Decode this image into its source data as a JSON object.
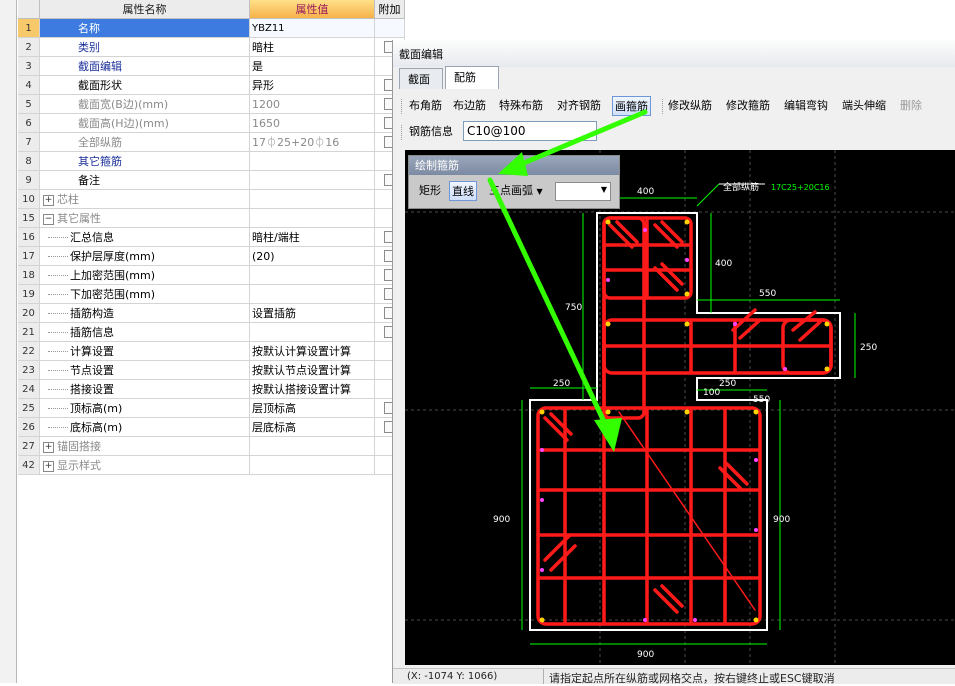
{
  "grid": {
    "headers": {
      "name": "属性名称",
      "value": "属性值",
      "extra": "附加"
    },
    "rows": [
      {
        "num": "1",
        "name": "名称",
        "value": "YBZ11",
        "check": false,
        "style": "sel"
      },
      {
        "num": "2",
        "name": "类别",
        "value": "暗柱",
        "check": true,
        "style": "blue"
      },
      {
        "num": "3",
        "name": "截面编辑",
        "value": "是",
        "check": false,
        "style": "blue"
      },
      {
        "num": "4",
        "name": "截面形状",
        "value": "异形",
        "check": true,
        "style": ""
      },
      {
        "num": "5",
        "name": "截面宽(B边)(mm)",
        "value": "1200",
        "check": true,
        "style": "gray"
      },
      {
        "num": "6",
        "name": "截面高(H边)(mm)",
        "value": "1650",
        "check": true,
        "style": "gray"
      },
      {
        "num": "7",
        "name": "全部纵筋",
        "value": "17⏀25+20⏀16",
        "check": true,
        "style": "gray"
      },
      {
        "num": "8",
        "name": "其它箍筋",
        "value": "",
        "check": false,
        "style": "blue"
      },
      {
        "num": "9",
        "name": "备注",
        "value": "",
        "check": true,
        "style": ""
      },
      {
        "num": "10",
        "name": "芯柱",
        "value": "",
        "check": false,
        "style": "group",
        "sign": "+"
      },
      {
        "num": "15",
        "name": "其它属性",
        "value": "",
        "check": false,
        "style": "group",
        "sign": "−"
      },
      {
        "num": "16",
        "name": "汇总信息",
        "value": "暗柱/端柱",
        "check": true,
        "style": "child"
      },
      {
        "num": "17",
        "name": "保护层厚度(mm)",
        "value": "(20)",
        "check": true,
        "style": "child"
      },
      {
        "num": "18",
        "name": "上加密范围(mm)",
        "value": "",
        "check": true,
        "style": "child"
      },
      {
        "num": "19",
        "name": "下加密范围(mm)",
        "value": "",
        "check": true,
        "style": "child"
      },
      {
        "num": "20",
        "name": "插筋构造",
        "value": "设置插筋",
        "check": true,
        "style": "child"
      },
      {
        "num": "21",
        "name": "插筋信息",
        "value": "",
        "check": true,
        "style": "child"
      },
      {
        "num": "22",
        "name": "计算设置",
        "value": "按默认计算设置计算",
        "check": false,
        "style": "child"
      },
      {
        "num": "23",
        "name": "节点设置",
        "value": "按默认节点设置计算",
        "check": false,
        "style": "child"
      },
      {
        "num": "24",
        "name": "搭接设置",
        "value": "按默认搭接设置计算",
        "check": false,
        "style": "child"
      },
      {
        "num": "25",
        "name": "顶标高(m)",
        "value": "层顶标高",
        "check": true,
        "style": "child"
      },
      {
        "num": "26",
        "name": "底标高(m)",
        "value": "层底标高",
        "check": true,
        "style": "child"
      },
      {
        "num": "27",
        "name": "锚固搭接",
        "value": "",
        "check": false,
        "style": "group",
        "sign": "+"
      },
      {
        "num": "42",
        "name": "显示样式",
        "value": "",
        "check": false,
        "style": "group",
        "sign": "+"
      }
    ]
  },
  "panel": {
    "title": "截面编辑",
    "tabs": [
      "截面",
      "配筋"
    ],
    "toolbar": [
      "布角筋",
      "布边筋",
      "特殊布筋",
      "对齐钢筋",
      "画箍筋",
      "修改纵筋",
      "修改箍筋",
      "编辑弯钩",
      "端头伸缩",
      "删除"
    ],
    "rebar_label": "钢筋信息",
    "rebar_value": "C10@100"
  },
  "drawbox": {
    "title": "绘制箍筋",
    "rect": "矩形",
    "line": "直线",
    "arc": "三点画弧"
  },
  "drawing": {
    "dims": {
      "top": "400",
      "right_top": "400",
      "left_750": "750",
      "arm": "550",
      "arm_h": "250",
      "left_250": "250",
      "mid_250": "250",
      "mid_100": "100",
      "right_550": "550",
      "left_900": "900",
      "right_900": "900",
      "bottom": "900"
    },
    "label_prefix": "全部纵筋",
    "label_value": "17C25+20C16"
  },
  "status": {
    "coord": "(X: -1074 Y: 1066)",
    "message": "请指定起点所在纵筋或网格交点，按右键终止或ESC键取消"
  },
  "colors": {
    "rebar": "#ff1a1a",
    "dim": "#00ff00",
    "arrow": "#33ff00",
    "outline": "#ffffff"
  }
}
